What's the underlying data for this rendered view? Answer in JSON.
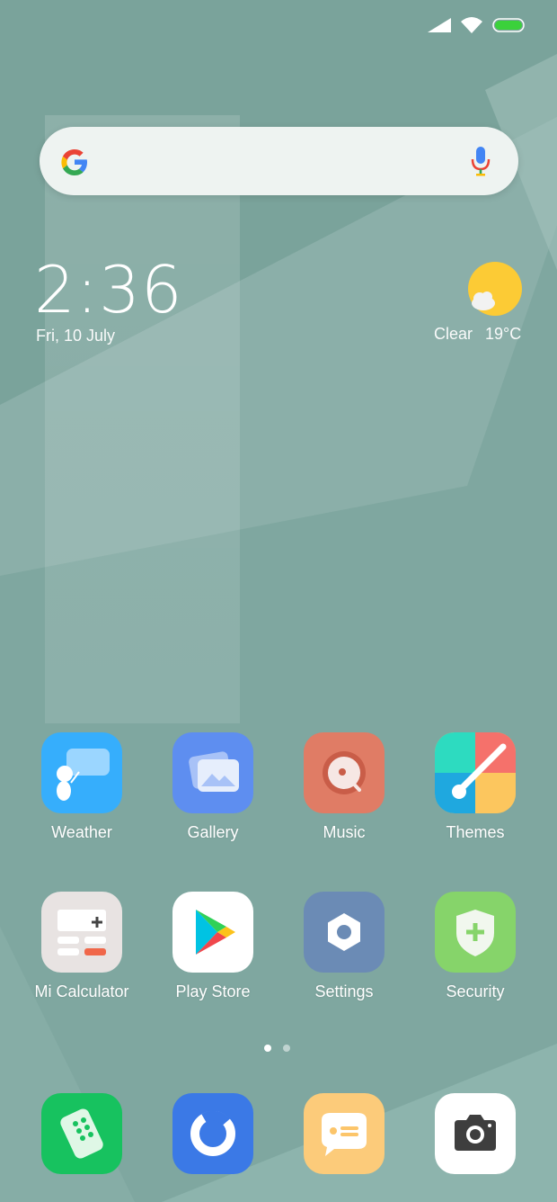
{
  "clock": {
    "time": "2:36",
    "date": "Fri, 10 July"
  },
  "weather": {
    "condition": "Clear",
    "temperature": "19°C"
  },
  "search_bar": {
    "logo": "google-g-icon",
    "voice": "microphone-icon"
  },
  "apps_row1": [
    {
      "label": "Weather",
      "icon": "weather-app-icon",
      "color": "#36aefc"
    },
    {
      "label": "Gallery",
      "icon": "gallery-app-icon",
      "color": "#5e8ef0"
    },
    {
      "label": "Music",
      "icon": "music-app-icon",
      "color": "#e07c65"
    },
    {
      "label": "Themes",
      "icon": "themes-app-icon",
      "color": "#fbbf5a"
    }
  ],
  "apps_row2": [
    {
      "label": "Mi Calculator",
      "icon": "calculator-app-icon",
      "color": "#e8e3e2"
    },
    {
      "label": "Play Store",
      "icon": "play-store-app-icon",
      "color": "#ffffff"
    },
    {
      "label": "Settings",
      "icon": "settings-app-icon",
      "color": "#6b8bb5"
    },
    {
      "label": "Security",
      "icon": "security-app-icon",
      "color": "#86d46a"
    }
  ],
  "dock": [
    {
      "icon": "phone-app-icon",
      "color": "#17c25f"
    },
    {
      "icon": "browser-app-icon",
      "color": "#3b79e6"
    },
    {
      "icon": "messages-app-icon",
      "color": "#fccb7a"
    },
    {
      "icon": "camera-app-icon",
      "color": "#ffffff"
    }
  ],
  "page_indicator": {
    "pages": 2,
    "current": 1
  },
  "status_bar": {
    "icons": [
      "signal-icon",
      "wifi-icon",
      "battery-icon"
    ],
    "battery_color": "#3bd13b"
  }
}
